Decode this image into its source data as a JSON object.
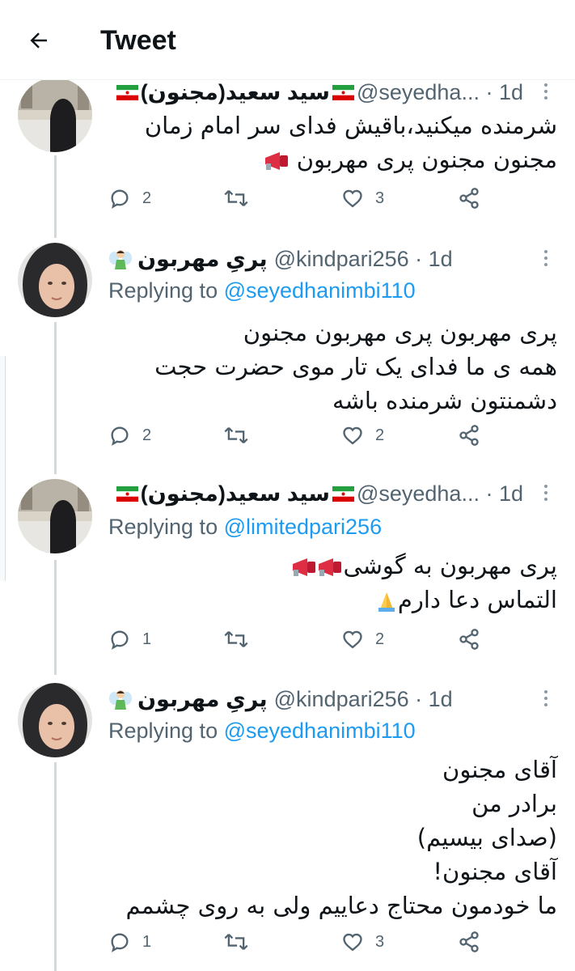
{
  "header": {
    "title": "Tweet",
    "back_icon": "back-arrow-icon"
  },
  "colors": {
    "link": "#1d9bf0",
    "muted": "#536471",
    "thread_line": "#cfd9de",
    "flag_green": "#239f40",
    "flag_red": "#da0000"
  },
  "tweets": [
    {
      "display_name": "سید سعید(مجنون)",
      "name_emoji": "iran-flag",
      "handle": "@seyedha...",
      "time": "1d",
      "replying_prefix": "",
      "replying_to": "",
      "lines": [
        "شرمنده میکنید،باقیش فدای سر امام زمان",
        "مجنون مجنون پری مهربون"
      ],
      "counts": {
        "reply": "2",
        "retweet": "",
        "like": "3"
      }
    },
    {
      "display_name": "پریِ مهربون",
      "name_emoji": "fairy-emoji",
      "handle": "@kindpari256",
      "time": "1d",
      "replying_prefix": "Replying to ",
      "replying_to": "@seyedhanimbi110",
      "lines": [
        "پری مهربون پری مهربون مجنون",
        "همه ی ما فدای یک تار موی حضرت حجت",
        "دشمنتون شرمنده باشه"
      ],
      "counts": {
        "reply": "2",
        "retweet": "",
        "like": "2"
      }
    },
    {
      "display_name": "سید سعید(مجنون)",
      "name_emoji": "iran-flag",
      "handle": "@seyedha...",
      "time": "1d",
      "replying_prefix": "Replying to ",
      "replying_to": "@limitedpari256",
      "lines": [
        "پری مهربون به گوشی",
        "التماس دعا دارم"
      ],
      "counts": {
        "reply": "1",
        "retweet": "",
        "like": "2"
      }
    },
    {
      "display_name": "پریِ مهربون",
      "name_emoji": "fairy-emoji",
      "handle": "@kindpari256",
      "time": "1d",
      "replying_prefix": "Replying to ",
      "replying_to": "@seyedhanimbi110",
      "lines": [
        "آقای مجنون",
        "برادر من",
        "(صدای بیسیم)",
        "آقای مجنون!",
        "ما خودمون محتاج دعاییم ولی به روی چشمم"
      ],
      "counts": {
        "reply": "1",
        "retweet": "",
        "like": "3"
      }
    }
  ]
}
